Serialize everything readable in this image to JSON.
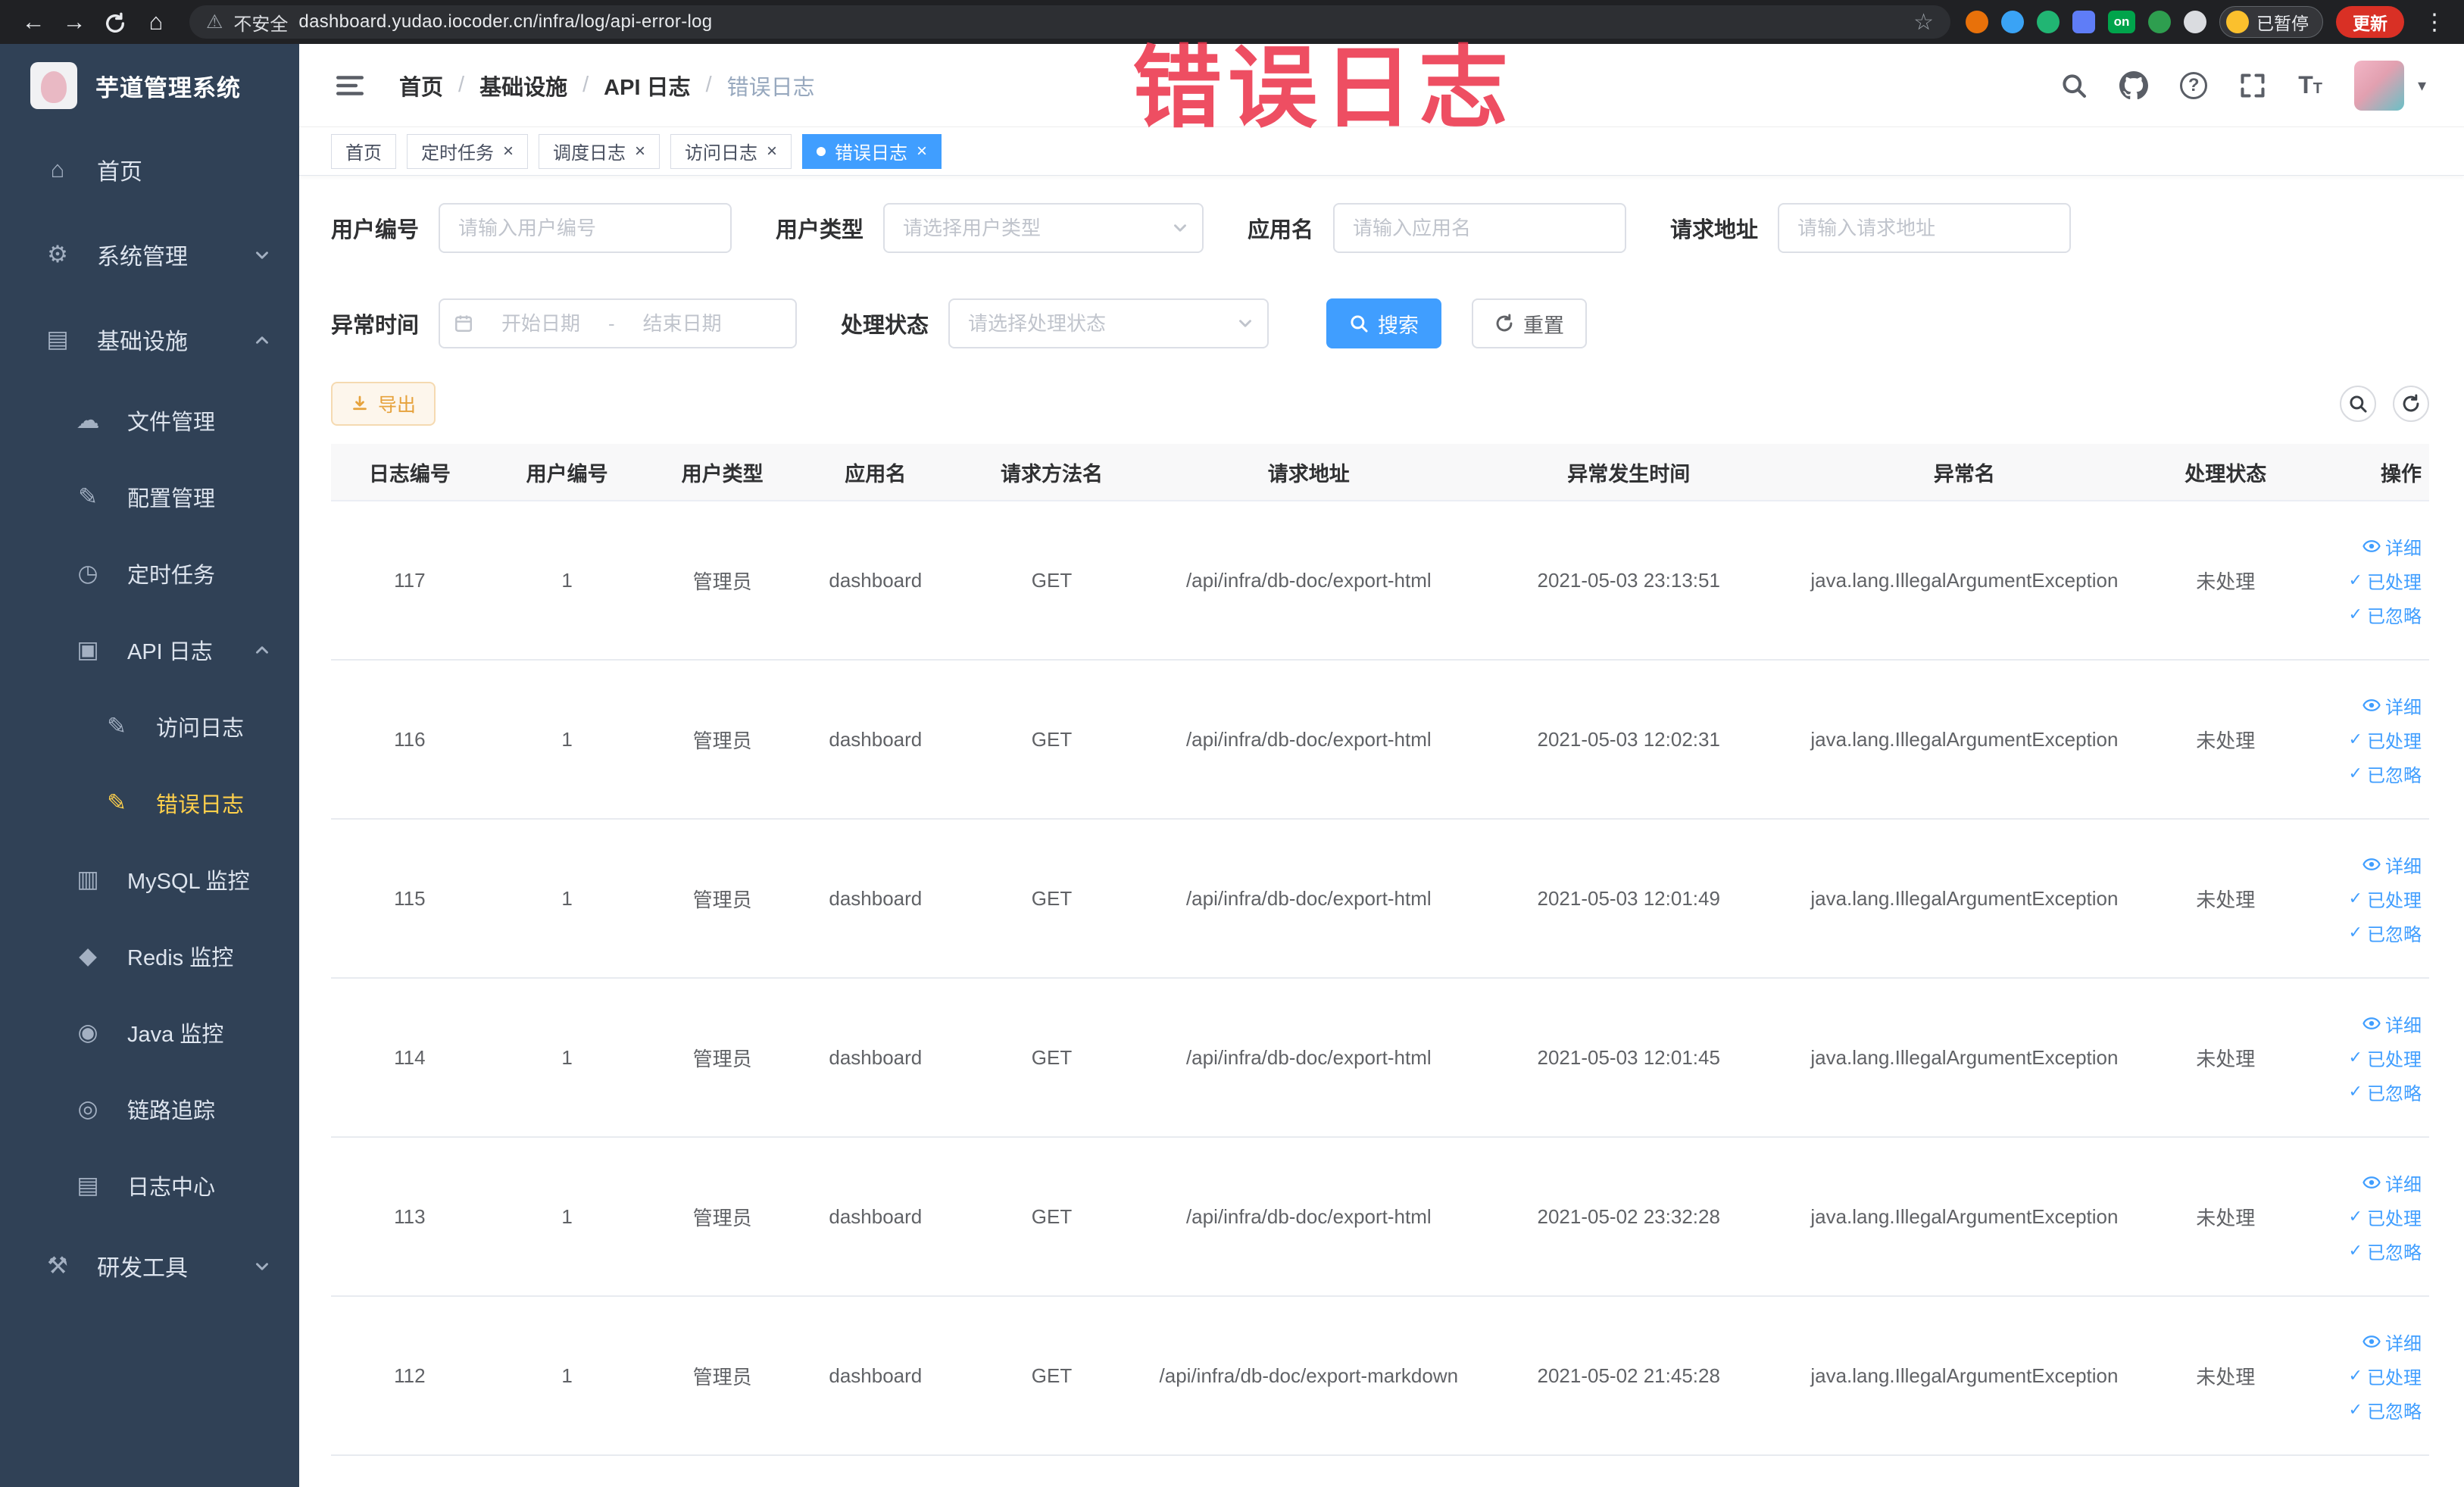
{
  "colors": {
    "accent": "#409eff",
    "sidebar_bg": "#304156",
    "sidebar_active": "#ffd04b",
    "annotation": "#ec364c",
    "warning": "#e6a23c",
    "update_button": "#d93025"
  },
  "icons": {
    "back": "←",
    "forward": "→",
    "home": "⌂",
    "warning": "⚠",
    "star": "☆",
    "kebab": "⋮",
    "check": "✓",
    "close": "×",
    "caret": "▾",
    "question": "?",
    "font_size": "T",
    "menu_home": "⌂",
    "menu_gear": "⚙",
    "menu_infra": "▤",
    "menu_cloud": "☁",
    "menu_edit": "✎",
    "menu_clock": "◷",
    "menu_doc": "▣",
    "menu_db": "▥",
    "menu_redis": "◆",
    "menu_java": "◉",
    "menu_trace": "◎",
    "menu_logcenter": "▤",
    "menu_tools": "⚒"
  },
  "browser": {
    "security_label": "不安全",
    "url": "dashboard.yudao.iocoder.cn/infra/log/api-error-log",
    "extension_on_label": "on",
    "paused_badge": "已暂停",
    "update_button": "更新"
  },
  "annotation": {
    "text": "错误日志"
  },
  "sidebar": {
    "title": "芋道管理系统",
    "menu": [
      {
        "label": "首页"
      },
      {
        "label": "系统管理"
      },
      {
        "label": "基础设施"
      },
      {
        "label": "文件管理"
      },
      {
        "label": "配置管理"
      },
      {
        "label": "定时任务"
      },
      {
        "label": "API 日志"
      },
      {
        "label": "访问日志"
      },
      {
        "label": "错误日志"
      },
      {
        "label": "MySQL 监控"
      },
      {
        "label": "Redis 监控"
      },
      {
        "label": "Java 监控"
      },
      {
        "label": "链路追踪"
      },
      {
        "label": "日志中心"
      },
      {
        "label": "研发工具"
      }
    ]
  },
  "breadcrumb": {
    "separator": "/",
    "items": [
      "首页",
      "基础设施",
      "API 日志",
      "错误日志"
    ]
  },
  "tabs": [
    {
      "label": "首页"
    },
    {
      "label": "定时任务"
    },
    {
      "label": "调度日志"
    },
    {
      "label": "访问日志"
    },
    {
      "label": "错误日志"
    }
  ],
  "filters": {
    "user_id": {
      "label": "用户编号",
      "placeholder": "请输入用户编号"
    },
    "user_type": {
      "label": "用户类型",
      "placeholder": "请选择用户类型"
    },
    "app_name": {
      "label": "应用名",
      "placeholder": "请输入应用名"
    },
    "request_url": {
      "label": "请求地址",
      "placeholder": "请输入请求地址"
    },
    "exception_time": {
      "label": "异常时间",
      "start_placeholder": "开始日期",
      "end_placeholder": "结束日期",
      "separator": "-"
    },
    "process_status": {
      "label": "处理状态",
      "placeholder": "请选择处理状态"
    },
    "search_button": "搜索",
    "reset_button": "重置"
  },
  "toolbar": {
    "export_button": "导出"
  },
  "table": {
    "headers": [
      "日志编号",
      "用户编号",
      "用户类型",
      "应用名",
      "请求方法名",
      "请求地址",
      "异常发生时间",
      "异常名",
      "处理状态",
      "操作"
    ],
    "action_labels": {
      "detail": "详细",
      "process": "已处理",
      "ignore": "已忽略"
    },
    "rows": [
      {
        "id": "117",
        "user_id": "1",
        "user_type": "管理员",
        "app": "dashboard",
        "method": "GET",
        "url": "/api/infra/db-doc/export-html",
        "time": "2021-05-03 23:13:51",
        "exception": "java.lang.IllegalArgumentException",
        "status": "未处理"
      },
      {
        "id": "116",
        "user_id": "1",
        "user_type": "管理员",
        "app": "dashboard",
        "method": "GET",
        "url": "/api/infra/db-doc/export-html",
        "time": "2021-05-03 12:02:31",
        "exception": "java.lang.IllegalArgumentException",
        "status": "未处理"
      },
      {
        "id": "115",
        "user_id": "1",
        "user_type": "管理员",
        "app": "dashboard",
        "method": "GET",
        "url": "/api/infra/db-doc/export-html",
        "time": "2021-05-03 12:01:49",
        "exception": "java.lang.IllegalArgumentException",
        "status": "未处理"
      },
      {
        "id": "114",
        "user_id": "1",
        "user_type": "管理员",
        "app": "dashboard",
        "method": "GET",
        "url": "/api/infra/db-doc/export-html",
        "time": "2021-05-03 12:01:45",
        "exception": "java.lang.IllegalArgumentException",
        "status": "未处理"
      },
      {
        "id": "113",
        "user_id": "1",
        "user_type": "管理员",
        "app": "dashboard",
        "method": "GET",
        "url": "/api/infra/db-doc/export-html",
        "time": "2021-05-02 23:32:28",
        "exception": "java.lang.IllegalArgumentException",
        "status": "未处理"
      },
      {
        "id": "112",
        "user_id": "1",
        "user_type": "管理员",
        "app": "dashboard",
        "method": "GET",
        "url": "/api/infra/db-doc/export-markdown",
        "time": "2021-05-02 21:45:28",
        "exception": "java.lang.IllegalArgumentException",
        "status": "未处理"
      }
    ]
  }
}
